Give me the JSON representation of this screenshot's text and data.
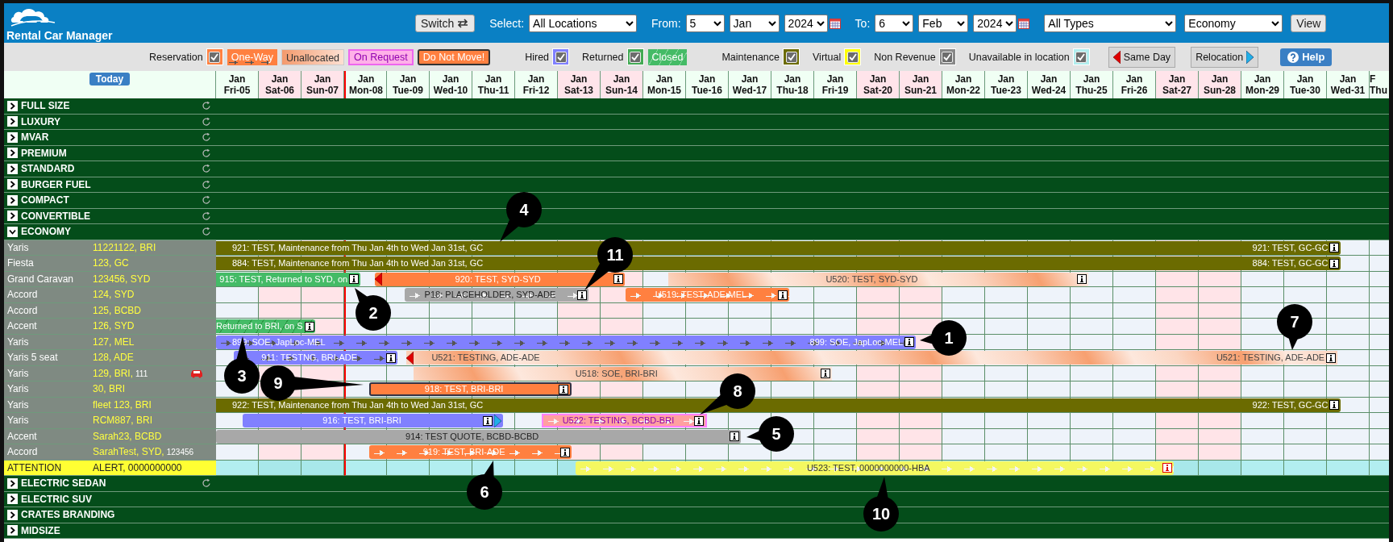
{
  "header": {
    "title": "Rental Car Manager",
    "switch_button": "Switch",
    "select_label": "Select:",
    "location": "All Locations",
    "from_label": "From:",
    "from_day": "5",
    "from_month": "Jan",
    "from_year": "2024",
    "to_label": "To:",
    "to_day": "6",
    "to_month": "Feb",
    "to_year": "2024",
    "vehicle_type": "All Types",
    "vehicle_class": "Economy",
    "view_button": "View"
  },
  "legend": [
    {
      "kind": "filter",
      "label": "Reservation",
      "checked": true,
      "color": "#ff8040"
    },
    {
      "kind": "one_way",
      "label": "One-Way"
    },
    {
      "kind": "unallocated",
      "label": "Unallocated"
    },
    {
      "kind": "on_request",
      "label": "On Request"
    },
    {
      "kind": "do_not_move",
      "label": "Do Not Move!"
    },
    {
      "kind": "filter",
      "label": "Hired",
      "checked": true,
      "color": "#8080ff"
    },
    {
      "kind": "filter",
      "label": "Returned",
      "checked": true,
      "color": "#44aa55"
    },
    {
      "kind": "closed",
      "label": "Closed"
    },
    {
      "kind": "filter",
      "label": "Maintenance",
      "checked": true,
      "color": "#6b6b00"
    },
    {
      "kind": "filter",
      "label": "Virtual",
      "checked": true,
      "color": "#ffff00"
    },
    {
      "kind": "filter",
      "label": "Non Revenue",
      "checked": true,
      "color": "#888888"
    },
    {
      "kind": "filter",
      "label": "Unavailable in location",
      "checked": true,
      "color": "#b0eeee"
    },
    {
      "kind": "same_day",
      "label": "Same Day"
    },
    {
      "kind": "relocation",
      "label": "Relocation"
    },
    {
      "kind": "help",
      "label": "Help"
    }
  ],
  "timeline": {
    "today_button": "Today",
    "days": [
      {
        "month": "Jan",
        "day": "Fri-05",
        "weekend": false,
        "today": false
      },
      {
        "month": "Jan",
        "day": "Sat-06",
        "weekend": true,
        "today": false
      },
      {
        "month": "Jan",
        "day": "Sun-07",
        "weekend": true,
        "today": false
      },
      {
        "month": "Jan",
        "day": "Mon-08",
        "weekend": false,
        "today": true
      },
      {
        "month": "Jan",
        "day": "Tue-09",
        "weekend": false,
        "today": false
      },
      {
        "month": "Jan",
        "day": "Wed-10",
        "weekend": false,
        "today": false
      },
      {
        "month": "Jan",
        "day": "Thu-11",
        "weekend": false,
        "today": false
      },
      {
        "month": "Jan",
        "day": "Fri-12",
        "weekend": false,
        "today": false
      },
      {
        "month": "Jan",
        "day": "Sat-13",
        "weekend": true,
        "today": false
      },
      {
        "month": "Jan",
        "day": "Sun-14",
        "weekend": true,
        "today": false
      },
      {
        "month": "Jan",
        "day": "Mon-15",
        "weekend": false,
        "today": false
      },
      {
        "month": "Jan",
        "day": "Tue-16",
        "weekend": false,
        "today": false
      },
      {
        "month": "Jan",
        "day": "Wed-17",
        "weekend": false,
        "today": false
      },
      {
        "month": "Jan",
        "day": "Thu-18",
        "weekend": false,
        "today": false
      },
      {
        "month": "Jan",
        "day": "Fri-19",
        "weekend": false,
        "today": false
      },
      {
        "month": "Jan",
        "day": "Sat-20",
        "weekend": true,
        "today": false
      },
      {
        "month": "Jan",
        "day": "Sun-21",
        "weekend": true,
        "today": false
      },
      {
        "month": "Jan",
        "day": "Mon-22",
        "weekend": false,
        "today": false
      },
      {
        "month": "Jan",
        "day": "Tue-23",
        "weekend": false,
        "today": false
      },
      {
        "month": "Jan",
        "day": "Wed-24",
        "weekend": false,
        "today": false
      },
      {
        "month": "Jan",
        "day": "Thu-25",
        "weekend": false,
        "today": false
      },
      {
        "month": "Jan",
        "day": "Fri-26",
        "weekend": false,
        "today": false
      },
      {
        "month": "Jan",
        "day": "Sat-27",
        "weekend": true,
        "today": false
      },
      {
        "month": "Jan",
        "day": "Sun-28",
        "weekend": true,
        "today": false
      },
      {
        "month": "Jan",
        "day": "Mon-29",
        "weekend": false,
        "today": false
      },
      {
        "month": "Jan",
        "day": "Tue-30",
        "weekend": false,
        "today": false
      },
      {
        "month": "Jan",
        "day": "Wed-31",
        "weekend": false,
        "today": false
      },
      {
        "month": "F",
        "day": "Thu",
        "weekend": false,
        "today": false
      }
    ]
  },
  "categories": [
    {
      "name": "FULL SIZE",
      "expanded": false,
      "refresh": true
    },
    {
      "name": "LUXURY",
      "expanded": false,
      "refresh": true
    },
    {
      "name": "MVAR",
      "expanded": false,
      "refresh": true
    },
    {
      "name": "PREMIUM",
      "expanded": false,
      "refresh": true
    },
    {
      "name": "STANDARD",
      "expanded": false,
      "refresh": true
    },
    {
      "name": "BURGER FUEL",
      "expanded": false,
      "refresh": true
    },
    {
      "name": "COMPACT",
      "expanded": false,
      "refresh": true
    },
    {
      "name": "CONVERTIBLE",
      "expanded": false,
      "refresh": true
    },
    {
      "name": "ECONOMY",
      "expanded": true,
      "refresh": true,
      "vehicles": [
        {
          "kind": "vehicle",
          "model": "Yaris",
          "fleet": "11221122, BRI",
          "bookings": [
            {
              "kind": "maintenance",
              "info": true,
              "labels": [
                "921: TEST, Maintenance from Thu Jan 4th to Wed Jan 31st, GC",
                "921: TEST, GC-GC"
              ]
            }
          ]
        },
        {
          "kind": "vehicle",
          "model": "Fiesta",
          "fleet": "123, GC",
          "bookings": [
            {
              "kind": "maintenance",
              "info": true,
              "labels": [
                "884: TEST, Maintenance from Thu Jan 4th to Wed Jan 31st, GC",
                "884: TEST, GC-GC"
              ]
            }
          ]
        },
        {
          "kind": "vehicle",
          "model": "Grand Caravan",
          "fleet": "123456, SYD",
          "bookings": [
            {
              "kind": "returned",
              "info": true,
              "labels": [
                "915: TEST, Returned to SYD, on"
              ]
            },
            {
              "kind": "reservation",
              "info": true,
              "same_day": true,
              "labels": [
                "920: TEST, SYD-SYD"
              ]
            },
            {
              "kind": "unallocated",
              "info": true,
              "labels": [
                "U520: TEST, SYD-SYD"
              ]
            }
          ]
        },
        {
          "kind": "vehicle",
          "model": "Accord",
          "fleet": "124, SYD",
          "bookings": [
            {
              "kind": "quote",
              "info": true,
              "one_way": true,
              "labels": [
                "P18: PLACEHOLDER, SYD-ADE"
              ]
            },
            {
              "kind": "reservation",
              "info": true,
              "one_way": true,
              "labels": [
                "U519: TEST, ADE-MEL"
              ]
            }
          ]
        },
        {
          "kind": "vehicle",
          "model": "Accord",
          "fleet": "125, BCBD"
        },
        {
          "kind": "vehicle",
          "model": "Accent",
          "fleet": "126, SYD",
          "bookings": [
            {
              "kind": "closed",
              "info": true,
              "labels": [
                "Returned to BRI, on S"
              ]
            }
          ]
        },
        {
          "kind": "vehicle",
          "model": "Yaris",
          "fleet": "127, MEL",
          "bookings": [
            {
              "kind": "hired",
              "info": true,
              "one_way": true,
              "labels": [
                "899: SOE, JapLoc-MEL",
                "899: SOE, JapLoc-MEL"
              ]
            }
          ]
        },
        {
          "kind": "vehicle",
          "model": "Yaris 5 seat",
          "fleet": "128, ADE",
          "bookings": [
            {
              "kind": "hired",
              "info": true,
              "one_way": true,
              "labels": [
                "911: TESTNG, BRI-ADE"
              ]
            },
            {
              "kind": "unallocated",
              "info": true,
              "same_day": true,
              "labels": [
                "U521: TESTING, ADE-ADE",
                "U521: TESTING, ADE-ADE"
              ]
            }
          ]
        },
        {
          "kind": "vehicle",
          "model": "Yaris",
          "fleet": "129, BRI,",
          "note": "111",
          "flagged": true,
          "bookings": [
            {
              "kind": "unallocated",
              "info": true,
              "labels": [
                "U518: SOE, BRI-BRI"
              ]
            }
          ]
        },
        {
          "kind": "vehicle",
          "model": "Yaris",
          "fleet": "30, BRI",
          "bookings": [
            {
              "kind": "do_not_move",
              "info": true,
              "labels": [
                "918: TEST, BRI-BRI"
              ]
            }
          ]
        },
        {
          "kind": "vehicle",
          "model": "Yaris",
          "fleet": "fleet 123, BRI",
          "bookings": [
            {
              "kind": "maintenance",
              "info": true,
              "labels": [
                "922: TEST, Maintenance from Thu Jan 4th to Wed Jan 31st, GC",
                "922: TEST, GC-GC"
              ]
            }
          ]
        },
        {
          "kind": "vehicle",
          "model": "Yaris",
          "fleet": "RCM887, BRI",
          "bookings": [
            {
              "kind": "hired",
              "info": true,
              "relocation": true,
              "labels": [
                "916: TEST, BRI-BRI"
              ]
            },
            {
              "kind": "on_request",
              "info": true,
              "one_way": true,
              "labels": [
                "U522: TESTING, BCBD-BRI"
              ]
            }
          ]
        },
        {
          "kind": "vehicle",
          "model": "Accent",
          "fleet": "Sarah23, BCBD",
          "bookings": [
            {
              "kind": "quote",
              "info": true,
              "labels": [
                "914: TEST QUOTE, BCBD-BCBD"
              ]
            }
          ]
        },
        {
          "kind": "vehicle",
          "model": "Accord",
          "fleet": "SarahTest, SYD,",
          "note": "123456",
          "bookings": [
            {
              "kind": "reservation",
              "info": true,
              "one_way": true,
              "labels": [
                "919: TEST, BRI-ADE"
              ]
            }
          ]
        },
        {
          "kind": "alert",
          "model": "ATTENTION",
          "fleet": "ALERT, 0000000000",
          "bookings": [
            {
              "kind": "virtual",
              "info": true,
              "info_alert": true,
              "one_way": true,
              "labels": [
                "U523: TEST, 0000000000-HBA"
              ]
            }
          ]
        }
      ]
    },
    {
      "name": "ELECTRIC SEDAN",
      "expanded": false,
      "refresh": true
    },
    {
      "name": "ELECTRIC SUV",
      "expanded": false,
      "refresh": false
    },
    {
      "name": "CRATES BRANDING",
      "expanded": false,
      "refresh": false
    },
    {
      "name": "MIDSIZE",
      "expanded": false,
      "refresh": false
    }
  ],
  "callouts": [
    {
      "number": "1"
    },
    {
      "number": "2"
    },
    {
      "number": "3"
    },
    {
      "number": "4"
    },
    {
      "number": "5"
    },
    {
      "number": "6"
    },
    {
      "number": "7"
    },
    {
      "number": "8"
    },
    {
      "number": "9"
    },
    {
      "number": "10"
    },
    {
      "number": "11"
    }
  ]
}
